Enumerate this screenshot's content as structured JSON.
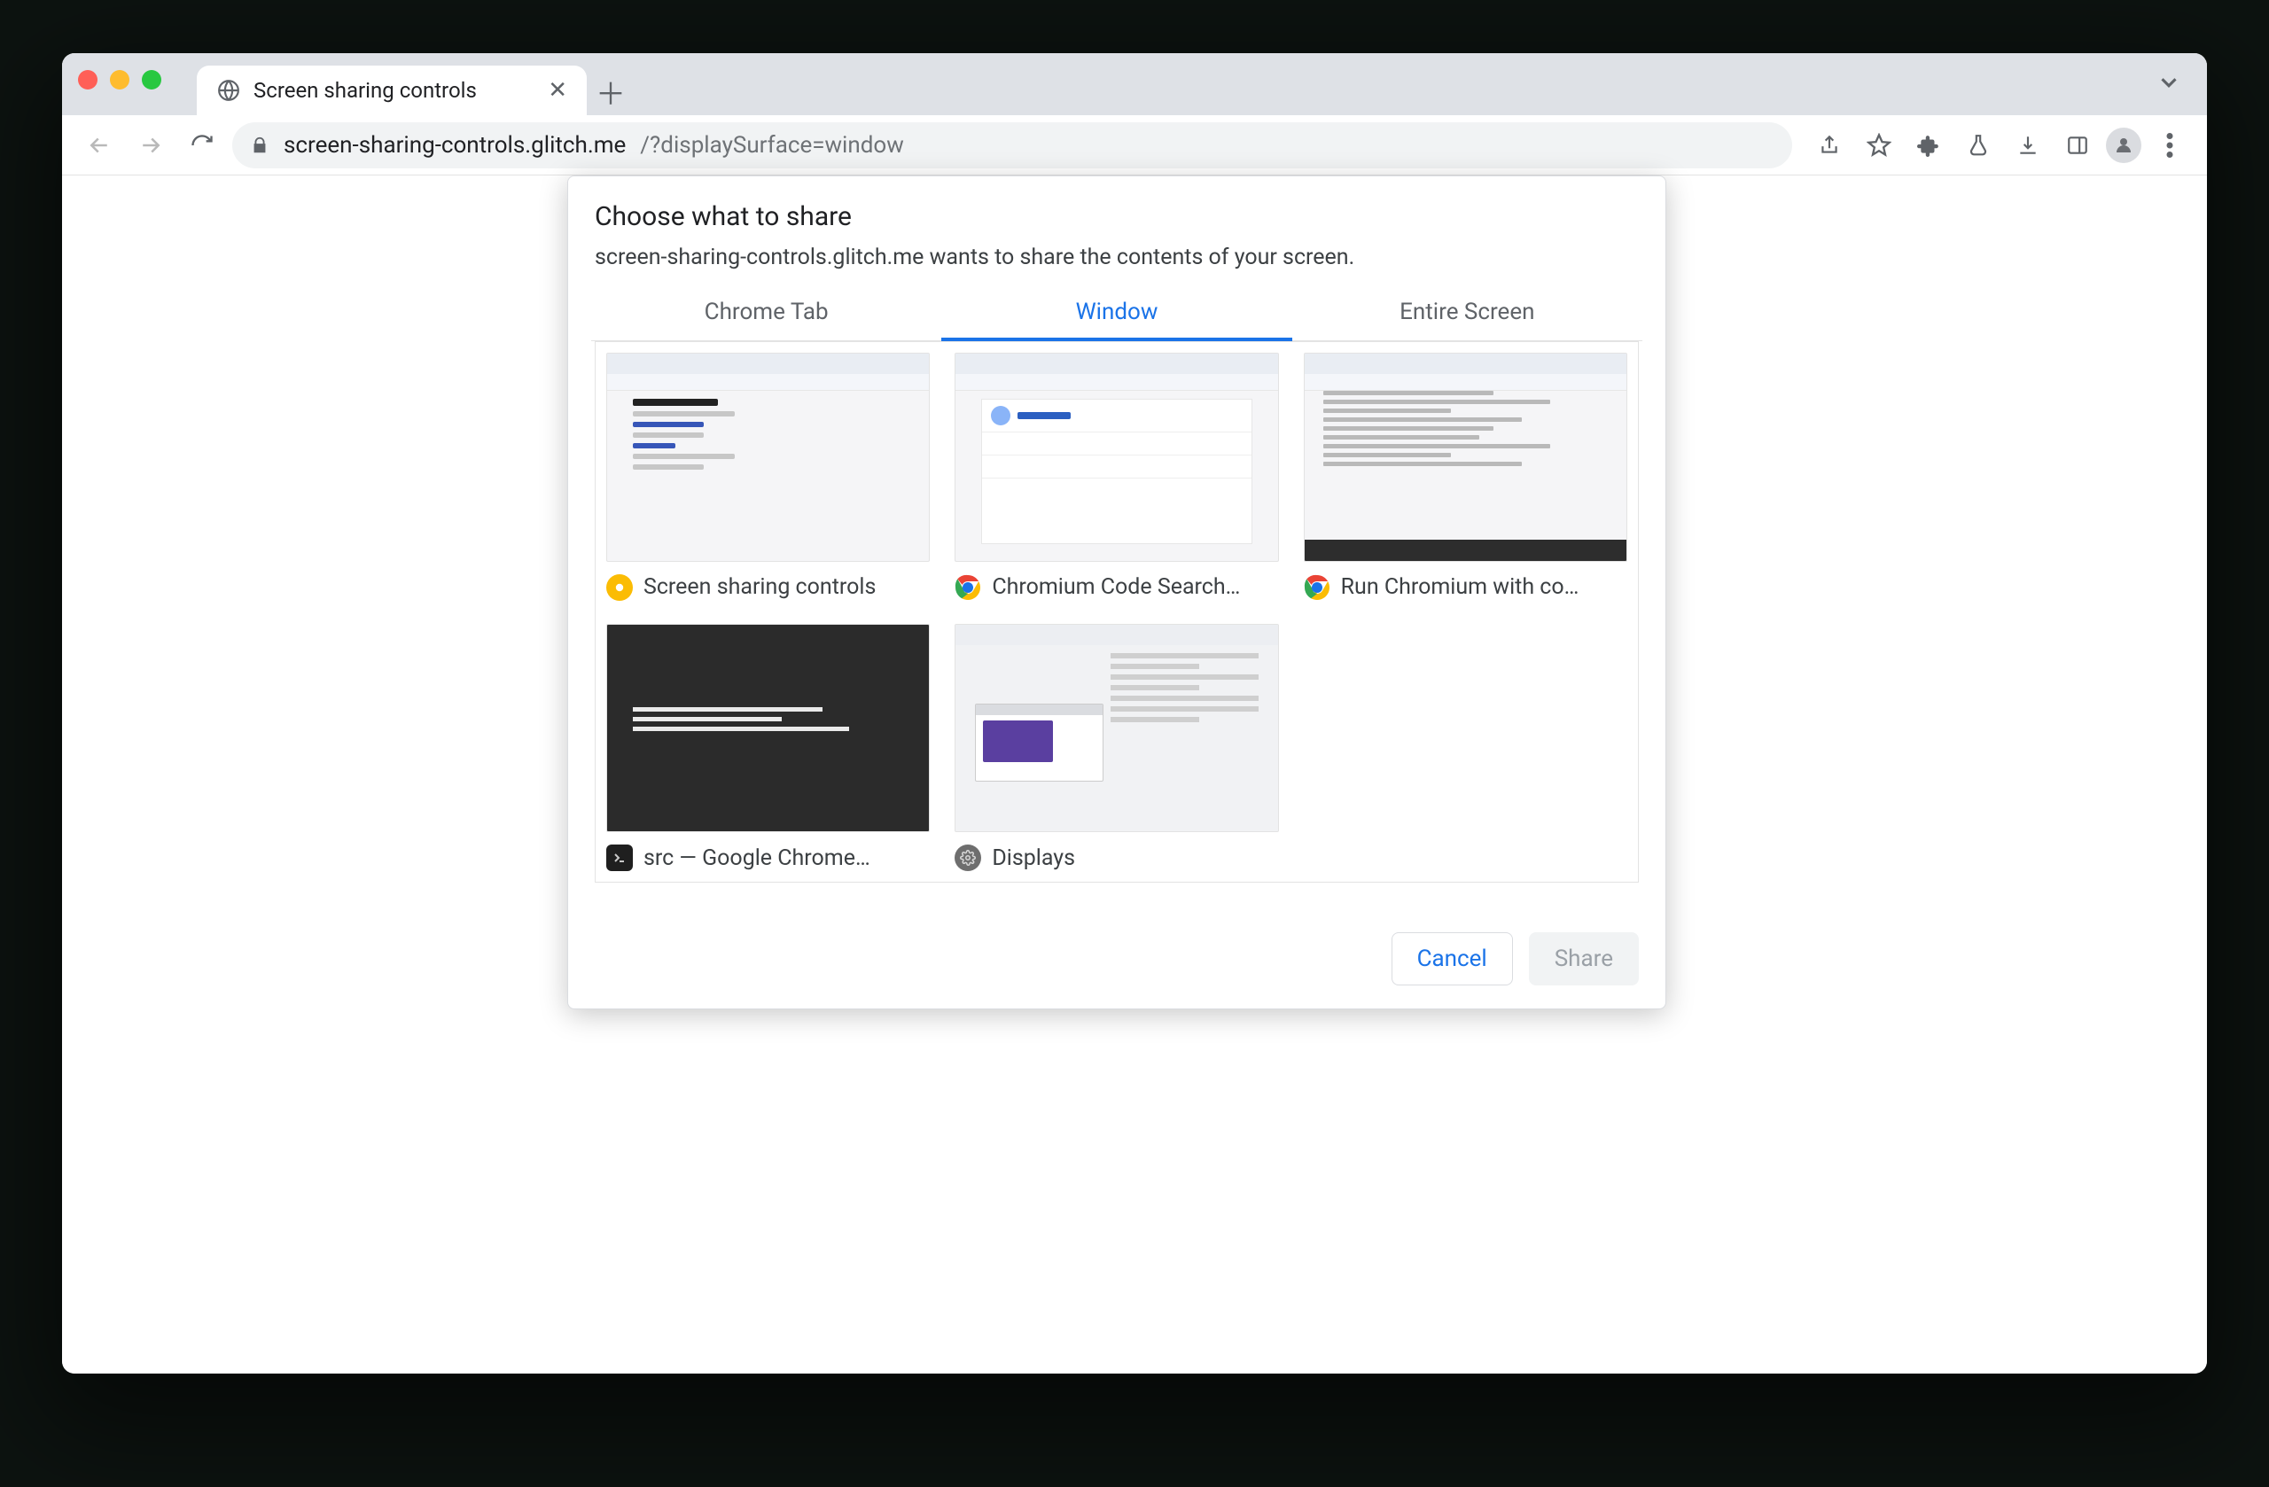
{
  "browser": {
    "tab_title": "Screen sharing controls",
    "address_host": "screen-sharing-controls.glitch.me",
    "address_path": "/?displaySurface=window"
  },
  "dialog": {
    "title": "Choose what to share",
    "subtitle": "screen-sharing-controls.glitch.me wants to share the contents of your screen.",
    "tabs": [
      {
        "label": "Chrome Tab"
      },
      {
        "label": "Window"
      },
      {
        "label": "Entire Screen"
      }
    ],
    "active_tab_index": 1,
    "windows": [
      {
        "label": "Screen sharing controls",
        "icon": "canary"
      },
      {
        "label": "Chromium Code Search…",
        "icon": "chrome"
      },
      {
        "label": "Run Chromium with co…",
        "icon": "chrome"
      },
      {
        "label": "src — Google Chrome…",
        "icon": "terminal"
      },
      {
        "label": "Displays",
        "icon": "settings"
      }
    ],
    "cancel_label": "Cancel",
    "share_label": "Share"
  },
  "icons": {
    "canary_color": "#fbbc04",
    "chrome_colors": {
      "red": "#ea4335",
      "yellow": "#fbbc04",
      "green": "#34a853",
      "blue": "#1a73e8"
    },
    "terminal_color": "#1f1f1f",
    "settings_color": "#6e6e6e"
  }
}
